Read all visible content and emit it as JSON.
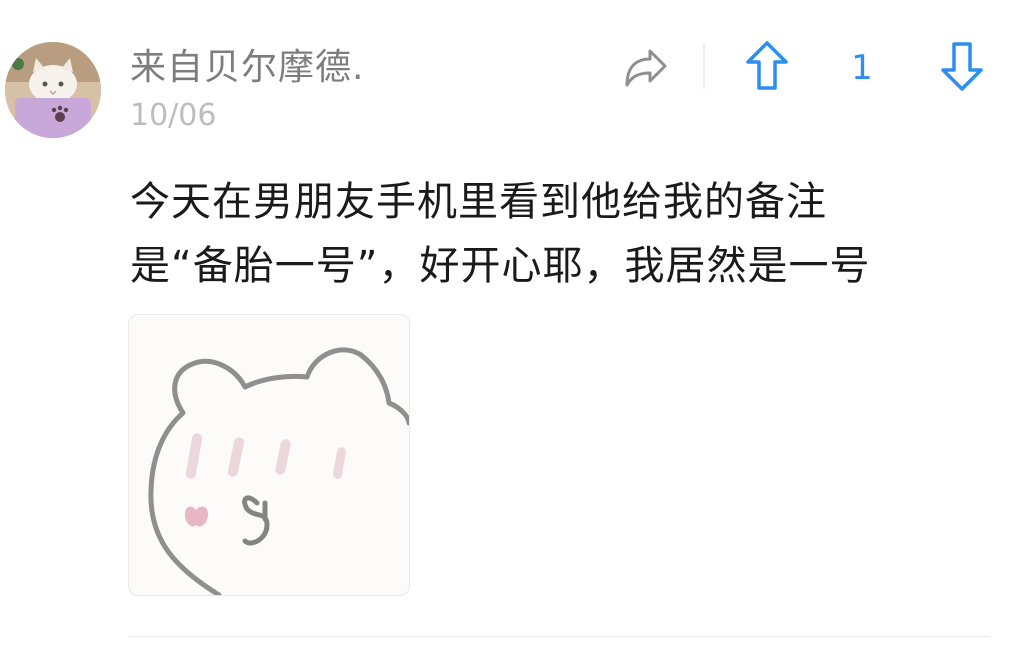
{
  "post": {
    "author": "来自贝尔摩德.",
    "date": "10/06",
    "vote_count": "1",
    "content_lines": [
      "今天在男朋友手机里看到他给我的备注",
      "是“备胎一号”，好开心耶，我居然是一号"
    ]
  },
  "icons": {
    "share": "share-arrow-icon",
    "upvote": "up-arrow-icon",
    "downvote": "down-arrow-icon"
  },
  "colors": {
    "accent": "#2b8ef0",
    "author_text": "#7d7d7d",
    "date_text": "#bdbdbd",
    "body_text": "#1a1a1a"
  }
}
